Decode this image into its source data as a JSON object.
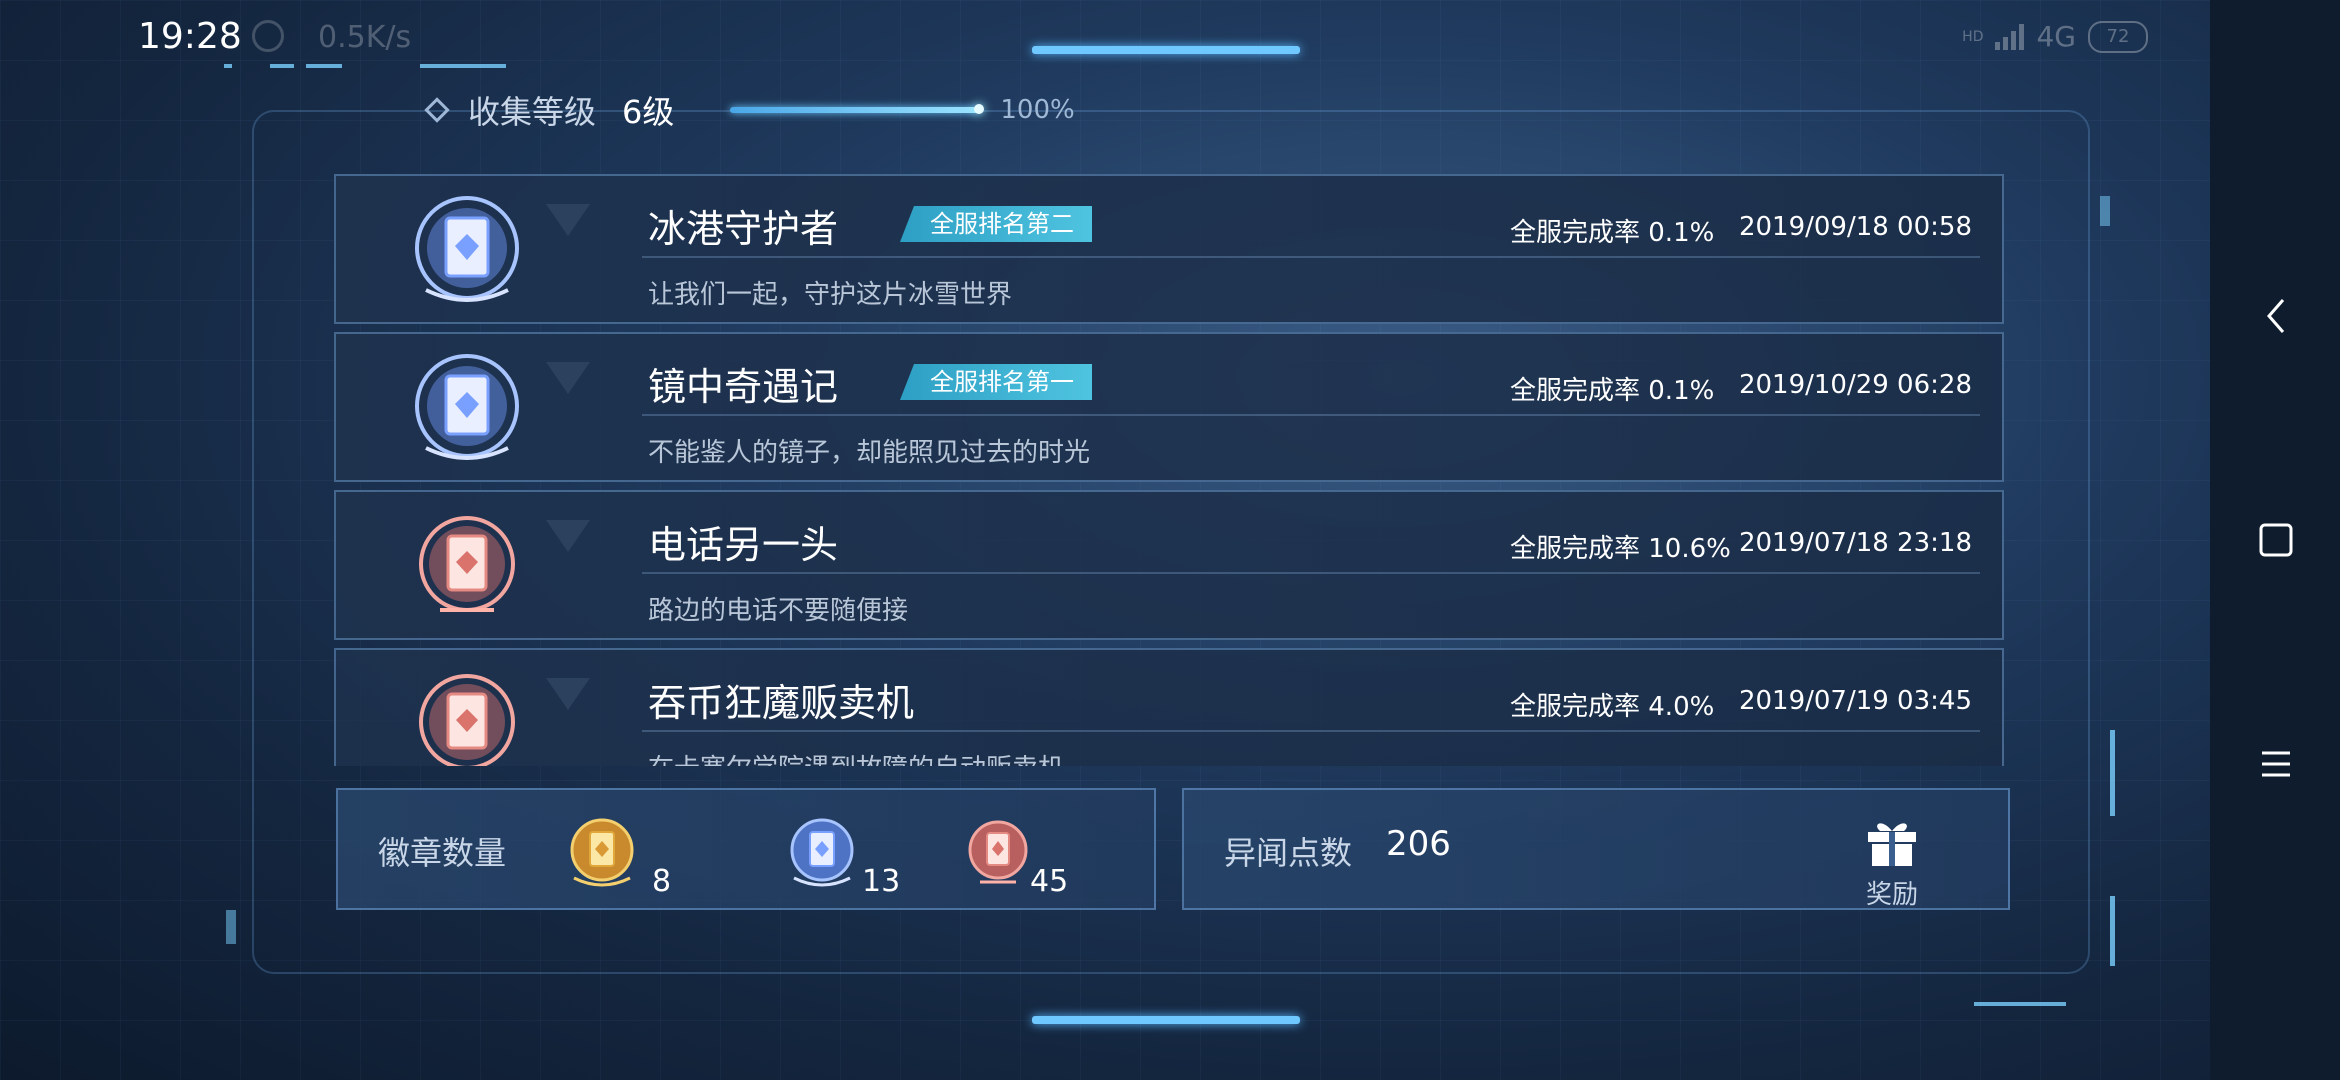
{
  "status_bar": {
    "time": "19:28",
    "net_speed": "0.5K/s",
    "network": "4G",
    "network_hd": "HD",
    "battery": "72"
  },
  "header": {
    "level_label": "收集等级",
    "level_value": "6级",
    "progress_text": "100%",
    "progress": 1.0
  },
  "achievements": [
    {
      "title": "冰港守护者",
      "rank_badge": "全服排名第二",
      "completion": "全服完成率 0.1%",
      "date": "2019/09/18 00:58",
      "description": "让我们一起，守护这片冰雪世界",
      "tier": "silver"
    },
    {
      "title": "镜中奇遇记",
      "rank_badge": "全服排名第一",
      "completion": "全服完成率 0.1%",
      "date": "2019/10/29 06:28",
      "description": "不能鉴人的镜子，却能照见过去的时光",
      "tier": "silver"
    },
    {
      "title": "电话另一头",
      "rank_badge": "",
      "completion": "全服完成率 10.6%",
      "date": "2019/07/18 23:18",
      "description": "路边的电话不要随便接",
      "tier": "bronze"
    },
    {
      "title": "吞币狂魔贩卖机",
      "rank_badge": "",
      "completion": "全服完成率 4.0%",
      "date": "2019/07/19 03:45",
      "description": "在卡塞尔学院遇到故障的自动贩卖机",
      "tier": "bronze"
    }
  ],
  "badges_panel": {
    "label": "徽章数量",
    "gold_count": "8",
    "silver_count": "13",
    "bronze_count": "45"
  },
  "points_panel": {
    "label": "异闻点数",
    "value": "206",
    "reward_label": "奖励"
  },
  "colors": {
    "accent": "#6fc8ff",
    "rank_badge": "#3bb2d4",
    "silver_medal": "#a8c4ff",
    "bronze_medal": "#f2a6a0",
    "gold_medal": "#e6b04a"
  }
}
